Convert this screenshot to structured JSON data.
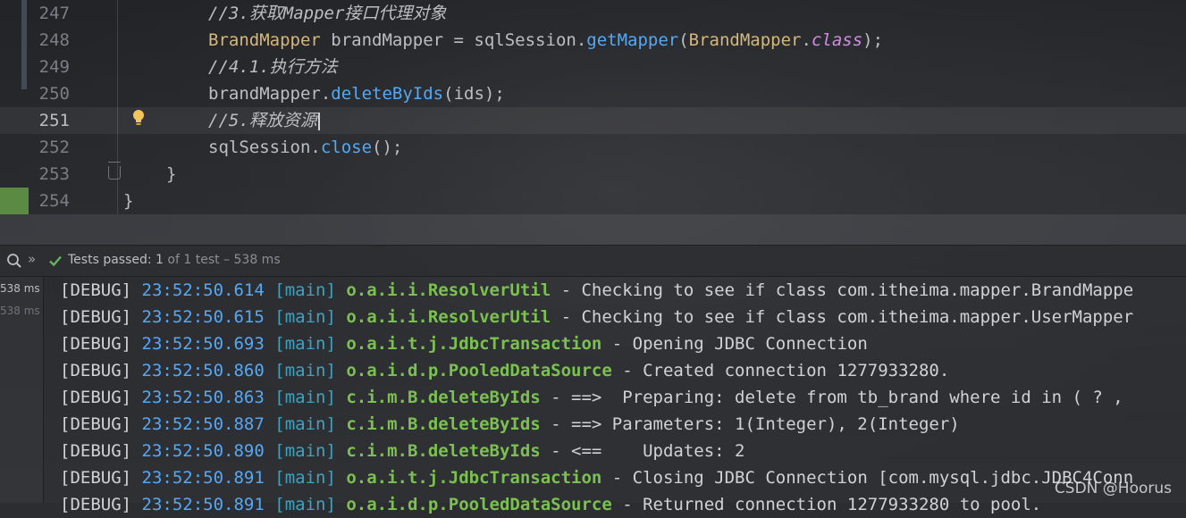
{
  "editor": {
    "lines": [
      {
        "number": "247",
        "tokens": [
          {
            "t": "//3.获取Mapper接口代理对象",
            "c": "cmt"
          }
        ]
      },
      {
        "number": "248",
        "tokens": [
          {
            "t": "BrandMapper",
            "c": "cls"
          },
          {
            "t": " brandMapper = sqlSession.",
            "c": ""
          },
          {
            "t": "getMapper",
            "c": "fn"
          },
          {
            "t": "(",
            "c": ""
          },
          {
            "t": "BrandMapper",
            "c": "cls"
          },
          {
            "t": ".",
            "c": ""
          },
          {
            "t": "class",
            "c": "kw"
          },
          {
            "t": ");",
            "c": ""
          }
        ]
      },
      {
        "number": "249",
        "tokens": [
          {
            "t": "//4.1.执行方法",
            "c": "cmt"
          }
        ]
      },
      {
        "number": "250",
        "tokens": [
          {
            "t": "brandMapper.",
            "c": ""
          },
          {
            "t": "deleteByIds",
            "c": "fn"
          },
          {
            "t": "(ids);",
            "c": ""
          }
        ]
      },
      {
        "number": "251",
        "tokens": [
          {
            "t": "//5.释放资源",
            "c": "cmt"
          }
        ],
        "active": true
      },
      {
        "number": "252",
        "tokens": [
          {
            "t": "sqlSession.",
            "c": ""
          },
          {
            "t": "close",
            "c": "fn"
          },
          {
            "t": "();",
            "c": ""
          }
        ]
      },
      {
        "number": "253",
        "tokens": [
          {
            "t": "}",
            "c": ""
          }
        ],
        "indent": "outer1"
      },
      {
        "number": "254",
        "tokens": [
          {
            "t": "}",
            "c": ""
          }
        ],
        "indent": "outer2"
      }
    ]
  },
  "test_toolbar": {
    "status_label": "Tests passed:",
    "passed": "1",
    "rest": "of 1 test – 538 ms",
    "icons": [
      "search-icon",
      "chevron-double-right-icon",
      "check-icon"
    ]
  },
  "test_tree": {
    "items": [
      "538 ms",
      "538 ms"
    ]
  },
  "console": {
    "lines": [
      {
        "level": "[DEBUG]",
        "time": "23:52:50.614",
        "thread": "[main]",
        "logger": "o.a.i.i.ResolverUtil",
        "msg": " - Checking to see if class com.itheima.mapper.BrandMappe"
      },
      {
        "level": "[DEBUG]",
        "time": "23:52:50.615",
        "thread": "[main]",
        "logger": "o.a.i.i.ResolverUtil",
        "msg": " - Checking to see if class com.itheima.mapper.UserMapper"
      },
      {
        "level": "[DEBUG]",
        "time": "23:52:50.693",
        "thread": "[main]",
        "logger": "o.a.i.t.j.JdbcTransaction",
        "msg": " - Opening JDBC Connection"
      },
      {
        "level": "[DEBUG]",
        "time": "23:52:50.860",
        "thread": "[main]",
        "logger": "o.a.i.d.p.PooledDataSource",
        "msg": " - Created connection 1277933280."
      },
      {
        "level": "[DEBUG]",
        "time": "23:52:50.863",
        "thread": "[main]",
        "logger": "c.i.m.B.deleteByIds",
        "msg": " - ==>  Preparing: delete from tb_brand where id in ( ? ,"
      },
      {
        "level": "[DEBUG]",
        "time": "23:52:50.887",
        "thread": "[main]",
        "logger": "c.i.m.B.deleteByIds",
        "msg": " - ==> Parameters: 1(Integer), 2(Integer)"
      },
      {
        "level": "[DEBUG]",
        "time": "23:52:50.890",
        "thread": "[main]",
        "logger": "c.i.m.B.deleteByIds",
        "msg": " - <==    Updates: 2"
      },
      {
        "level": "[DEBUG]",
        "time": "23:52:50.891",
        "thread": "[main]",
        "logger": "o.a.i.t.j.JdbcTransaction",
        "msg": " - Closing JDBC Connection [com.mysql.jdbc.JDBC4Conn"
      },
      {
        "level": "[DEBUG]",
        "time": "23:52:50.891",
        "thread": "[main]",
        "logger": "o.a.i.d.p.PooledDataSource",
        "msg": " - Returned connection 1277933280 to pool."
      }
    ]
  },
  "watermark": "CSDN @Hoorus",
  "colors": {
    "comment": "#bcbec4",
    "class": "#d5b778",
    "method": "#56a8f5",
    "keyword": "#cf8ee0",
    "timestamp": "#56a8f5",
    "thread": "#3fa3c0",
    "logger": "#7bc14f",
    "passed_check": "#5fb85c"
  }
}
